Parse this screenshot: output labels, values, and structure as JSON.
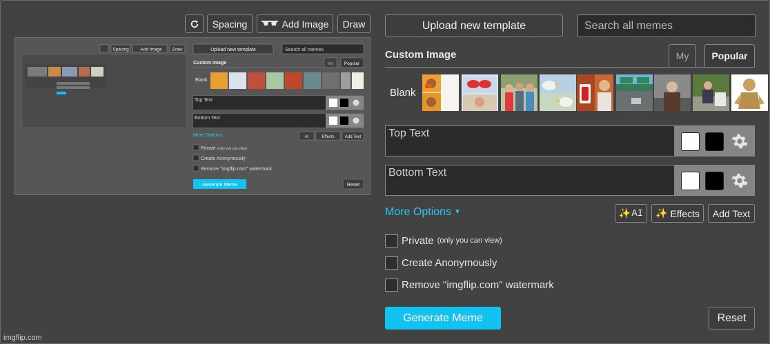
{
  "toolbar": {
    "spacing_label": "Spacing",
    "add_image_label": "Add Image",
    "draw_label": "Draw"
  },
  "preview": {
    "upload_label": "Upload new template",
    "search_placeholder": "Search all memes",
    "custom_image_label": "Custom Image",
    "tab_my": "My",
    "tab_popular": "Popular",
    "blank_label": "Blank",
    "top_text": "Top Text",
    "bottom_text": "Bottom Text",
    "more_options": "More Options",
    "ai_label": "AI",
    "effects_label": "Effects",
    "add_text_label": "Add Text",
    "private_label": "Private",
    "private_sub": "(only you can view)",
    "anon_label": "Create Anonymously",
    "watermark_label": "Remove \"imgflip.com\" watermark",
    "generate_label": "Generate Meme",
    "reset_label": "Reset"
  },
  "header": {
    "upload_label": "Upload new template",
    "search_placeholder": "Search all memes"
  },
  "templates": {
    "section_label": "Custom Image",
    "tabs": [
      {
        "label": "My",
        "active": false
      },
      {
        "label": "Popular",
        "active": true
      }
    ],
    "blank_label": "Blank",
    "thumbnails": [
      {
        "icon": "drake-meme-thumb"
      },
      {
        "icon": "two-buttons-meme-thumb"
      },
      {
        "icon": "distracted-boyfriend-meme-thumb"
      },
      {
        "icon": "bird-meme-thumb"
      },
      {
        "icon": "uno-draw-25-meme-thumb"
      },
      {
        "icon": "left-exit-ramp-meme-thumb"
      },
      {
        "icon": "bernie-meme-thumb"
      },
      {
        "icon": "running-away-meme-thumb"
      },
      {
        "icon": "cheems-meme-thumb"
      }
    ]
  },
  "text_boxes": {
    "top_placeholder": "Top Text",
    "bottom_placeholder": "Bottom Text",
    "colors": {
      "fill": "#ffffff",
      "outline": "#000000"
    }
  },
  "options": {
    "more_options_label": "More Options",
    "ai_label": "AI",
    "effects_label": "Effects",
    "add_text_label": "Add Text",
    "private_label": "Private",
    "private_sub": "(only you can view)",
    "anon_label": "Create Anonymously",
    "watermark_label": "Remove \"imgflip.com\" watermark"
  },
  "actions": {
    "generate_label": "Generate Meme",
    "reset_label": "Reset"
  },
  "footer": {
    "watermark": "imgflip.com"
  },
  "colors": {
    "background": "#424242",
    "accent": "#12c3f2",
    "link": "#2cc6f2"
  }
}
